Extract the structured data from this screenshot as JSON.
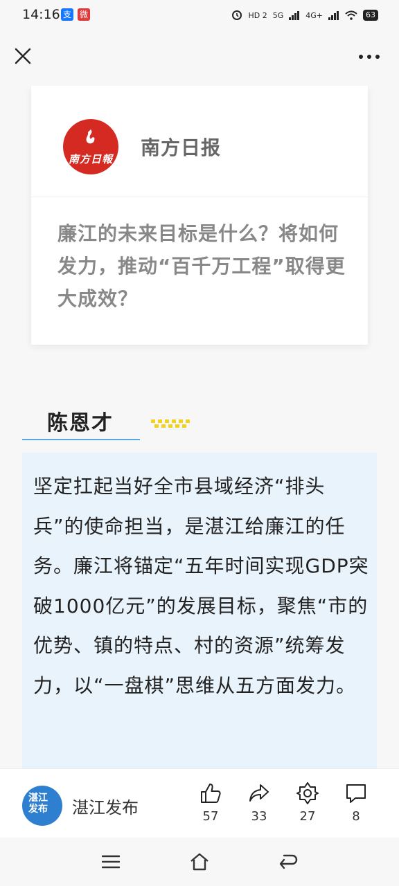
{
  "status_bar": {
    "time": "14:16",
    "apps": [
      "支",
      "微"
    ],
    "network_1": "HD 2",
    "network_2": "5G",
    "network_3": "4G+",
    "battery": "63"
  },
  "top_bar": {
    "close_icon": "close-icon",
    "more_icon": "more-dots-icon"
  },
  "source_card": {
    "logo_text": "南方日報",
    "source_name": "南方日报",
    "question": "廉江的未来目标是什么？将如何发力，推动“百千万工程”取得更大成效？"
  },
  "speaker": {
    "name": "陈恩才"
  },
  "answer": {
    "text": "坚定扛起当好全市县域经济“排头兵”的使命担当，是湛江给廉江的任务。廉江将锚定“五年时间实现GDP突破1000亿元”的发展目标，聚焦“市的优势、镇的特点、村的资源”统筹发力，以“一盘棋”思维从五方面发力。"
  },
  "bottom_bar": {
    "avatar_text": "湛江发布",
    "account_name": "湛江发布",
    "like_count": "57",
    "share_count": "33",
    "favorite_count": "27",
    "comment_count": "8"
  },
  "colors": {
    "accent_blue": "#5ba7dd",
    "answer_bg": "#e9f3fb",
    "logo_red": "#d42a22",
    "dots_yellow": "#f2d21c"
  }
}
